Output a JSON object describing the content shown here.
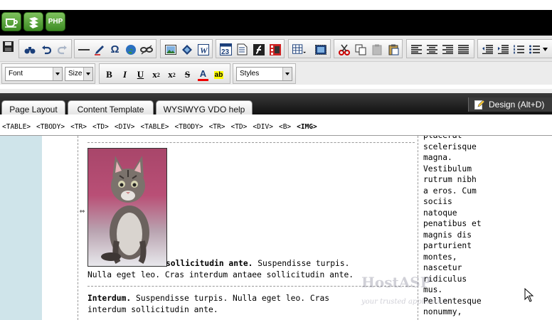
{
  "app_icons": [
    {
      "name": "coffee-cup-icon"
    },
    {
      "name": "layers-icon"
    },
    {
      "name": "php-icon",
      "label": "PHP"
    }
  ],
  "toolbar": {
    "font_select": "Font",
    "size_select": "Size",
    "styles_select": "Styles",
    "special_char": "Ω",
    "date_icon_text": "23"
  },
  "tabs": [
    {
      "label": "Page Layout"
    },
    {
      "label": "Content Template"
    },
    {
      "label": "WYSIWYG VDO help"
    }
  ],
  "design_button": "Design (Alt+D)",
  "tag_path": [
    "<TABLE>",
    "<TBODY>",
    "<TR>",
    "<TD>",
    "<DIV>",
    "<TABLE>",
    "<TBODY>",
    "<TR>",
    "<TD>",
    "<DIV>",
    "<B>",
    "<IMG>"
  ],
  "content": {
    "para1_bold": "sollicitudin ante.",
    "para1_rest_line1": " Suspendisse turpis.",
    "para1_line2": "Nulla eget leo. Cras interdum antaee sollicitudin ante.",
    "para2_bold": "Interdum.",
    "para2_rest_line1": " Suspendisse turpis. Nulla eget leo. Cras",
    "para2_line2": "interdum sollicitudin ante.",
    "right_column": "placerat\nscelerisque\nmagna.\nVestibulum\nrutrum nibh\na eros. Cum\nsociis\nnatoque\npenatibus et\nmagnis dis\nparturient\nmontes,\nnascetur\nridiculus\nmus.\nPellentesque\nnonummy,"
  },
  "watermark": {
    "title": "HostASP",
    "subtitle": "your trusted application"
  },
  "colors": {
    "accent_green": "#4a9a2e",
    "tab_bar": "#1a1a1a",
    "left_column": "#cfe4ea"
  }
}
